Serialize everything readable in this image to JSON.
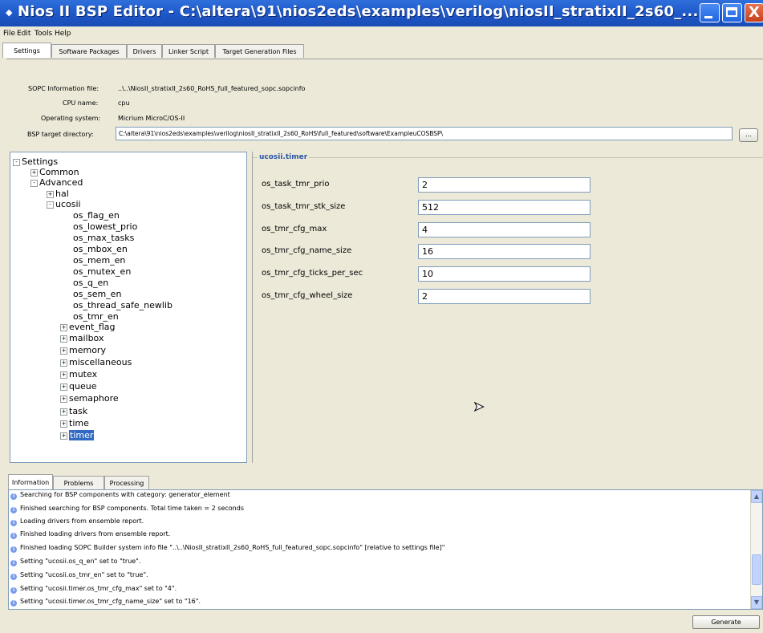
{
  "window": {
    "title": "Nios II BSP Editor - C:\\altera\\91\\nios2eds\\examples\\verilog\\niosII_stratixII_2s60_...",
    "app_icon": "nios-ii-icon",
    "min_icon": "minimize-icon",
    "max_icon": "maximize-icon",
    "close_icon": "close-icon",
    "close_glyph": "X"
  },
  "menu": [
    "File",
    "Edit",
    "Tools",
    "Help"
  ],
  "tabs": [
    "Settings",
    "Software Packages",
    "Drivers",
    "Linker Script",
    "Target Generation Files"
  ],
  "settings": {
    "sopc_label": "SOPC Information file:",
    "sopc_value": "..\\..\\NiosII_stratixII_2s60_RoHS_full_featured_sopc.sopcinfo",
    "cpu_label": "CPU name:",
    "cpu_value": "cpu",
    "os_label": "Operating system:",
    "os_value": "Micrium MicroC/OS-II",
    "bsp_label": "BSP target directory:",
    "bsp_value": "C:\\altera\\91\\nios2eds\\examples\\verilog\\niosII_stratixII_2s60_RoHS\\full_featured\\software\\ExampleuCOSBSP\\",
    "browse_label": "..."
  },
  "tree": {
    "root": "Settings",
    "common": "Common",
    "advanced": "Advanced",
    "hal": "hal",
    "ucosii": "ucosii",
    "leaves": [
      "os_flag_en",
      "os_lowest_prio",
      "os_max_tasks",
      "os_mbox_en",
      "os_mem_en",
      "os_mutex_en",
      "os_q_en",
      "os_sem_en",
      "os_thread_safe_newlib",
      "os_tmr_en"
    ],
    "groups": [
      "event_flag",
      "mailbox",
      "memory",
      "miscellaneous",
      "mutex",
      "queue",
      "semaphore",
      "task",
      "time",
      "timer"
    ]
  },
  "timer": {
    "group_title": "ucosii.timer",
    "props": [
      {
        "name": "os_task_tmr_prio",
        "value": "2"
      },
      {
        "name": "os_task_tmr_stk_size",
        "value": "512"
      },
      {
        "name": "os_tmr_cfg_max",
        "value": "4"
      },
      {
        "name": "os_tmr_cfg_name_size",
        "value": "16"
      },
      {
        "name": "os_tmr_cfg_ticks_per_sec",
        "value": "10"
      },
      {
        "name": "os_tmr_cfg_wheel_size",
        "value": "2"
      }
    ]
  },
  "bottom_tabs": [
    "Information",
    "Problems",
    "Processing"
  ],
  "log": [
    "Searching for BSP components with category: generator_element",
    "Finished searching for BSP components. Total time taken = 2 seconds",
    "Loading drivers from ensemble report.",
    "Finished loading drivers from ensemble report.",
    "Finished loading SOPC Builder system info file \"..\\..\\NiosII_stratixII_2s60_RoHS_full_featured_sopc.sopcinfo\" [relative to settings file]\"",
    "Setting \"ucosii.os_q_en\" set to \"true\".",
    "Setting \"ucosii.os_tmr_en\" set to \"true\".",
    "Setting \"ucosii.timer.os_tmr_cfg_max\" set to \"4\".",
    "Setting \"ucosii.timer.os_tmr_cfg_name_size\" set to \"16\"."
  ],
  "generate_label": "Generate"
}
